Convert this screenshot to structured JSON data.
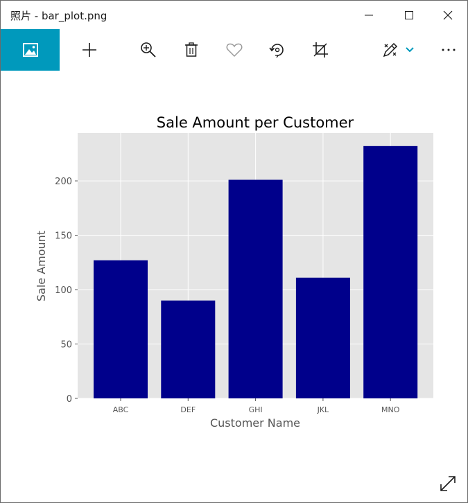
{
  "window": {
    "title": "照片 - bar_plot.png"
  },
  "toolbar": {
    "items": [
      {
        "icon": "image-icon",
        "active": true
      },
      {
        "icon": "add-icon"
      },
      {
        "icon": "zoom-in-icon"
      },
      {
        "icon": "delete-icon"
      },
      {
        "icon": "heart-icon"
      },
      {
        "icon": "rotate-icon"
      },
      {
        "icon": "crop-icon"
      },
      {
        "icon": "edit-icon"
      },
      {
        "icon": "chevron-down-icon"
      },
      {
        "icon": "more-icon"
      }
    ],
    "accent_color": "#0099bc"
  },
  "chart_data": {
    "type": "bar",
    "title": "Sale Amount per Customer",
    "xlabel": "Customer Name",
    "ylabel": "Sale Amount",
    "categories": [
      "ABC",
      "DEF",
      "GHI",
      "JKL",
      "MNO"
    ],
    "values": [
      127,
      90,
      201,
      111,
      232
    ],
    "ylim": [
      0,
      244
    ],
    "yticks": [
      0,
      50,
      100,
      150,
      200
    ],
    "grid": true,
    "style": "ggplot",
    "bar_color": "#00008b",
    "plot_background": "#e5e5e5"
  }
}
